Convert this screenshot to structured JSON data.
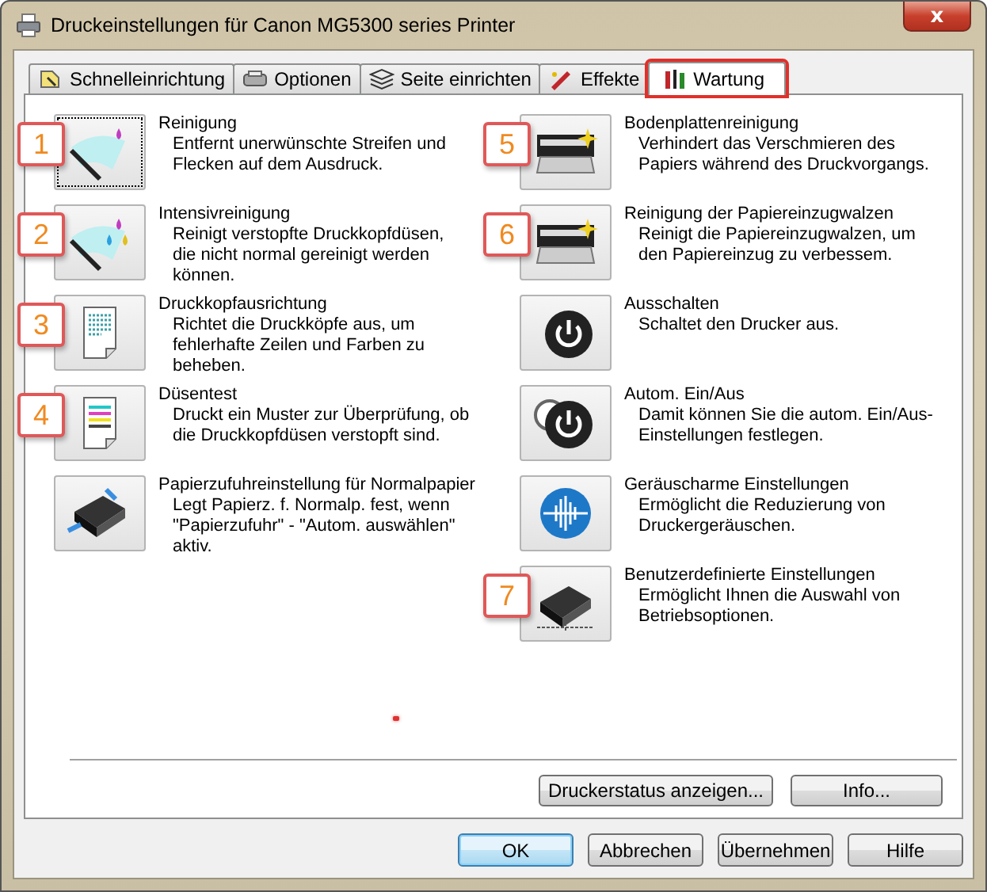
{
  "window": {
    "title": "Druckeinstellungen für Canon MG5300 series Printer",
    "close": "x"
  },
  "tabs": [
    {
      "label": "Schnelleinrichtung",
      "selected": false,
      "highlighted": false
    },
    {
      "label": "Optionen",
      "selected": false,
      "highlighted": false
    },
    {
      "label": "Seite einrichten",
      "selected": false,
      "highlighted": false
    },
    {
      "label": "Effekte",
      "selected": false,
      "highlighted": false
    },
    {
      "label": "Wartung",
      "selected": true,
      "highlighted": true
    }
  ],
  "left_items": [
    {
      "title": "Reinigung",
      "description": "Entfernt unerwünschte Streifen und Flecken auf dem Ausdruck.",
      "callout": "1",
      "focused": true
    },
    {
      "title": "Intensivreinigung",
      "description": "Reinigt verstopfte Druckkopfdüsen, die nicht normal gereinigt werden können.",
      "callout": "2",
      "focused": false
    },
    {
      "title": "Druckkopfausrichtung",
      "description": "Richtet die Druckköpfe aus, um fehlerhafte Zeilen und Farben zu beheben.",
      "callout": "3",
      "focused": false
    },
    {
      "title": "Düsentest",
      "description": "Druckt ein Muster zur Überprüfung, ob die Druckkopfdüsen verstopft sind.",
      "callout": "4",
      "focused": false
    },
    {
      "title": "Papierzufuhreinstellung für Normalpapier",
      "description": "Legt Papierz. f. Normalp. fest, wenn \"Papierzufuhr\" - \"Autom. auswählen\" aktiv.",
      "focused": false
    }
  ],
  "right_items": [
    {
      "title": "Bodenplattenreinigung",
      "description": "Verhindert das Verschmieren des Papiers während des Druckvorgangs.",
      "callout": "5",
      "focused": false
    },
    {
      "title": "Reinigung der Papiereinzugwalzen",
      "description": "Reinigt die Papiereinzugwalzen, um den Papiereinzug zu verbessem.",
      "callout": "6",
      "focused": false
    },
    {
      "title": "Ausschalten",
      "description": "Schaltet den Drucker aus.",
      "focused": false
    },
    {
      "title": "Autom. Ein/Aus",
      "description": "Damit können Sie die autom. Ein/Aus-Einstellungen festlegen.",
      "focused": false
    },
    {
      "title": "Geräuscharme Einstellungen",
      "description": "Ermöglicht die Reduzierung von Druckergeräuschen.",
      "focused": false
    },
    {
      "title": "Benutzerdefinierte Einstellungen",
      "description": "Ermöglicht Ihnen die Auswahl von Betriebsoptionen.",
      "callout": "7",
      "focused": false
    }
  ],
  "panel_buttons": [
    "Druckerstatus anzeigen...",
    "Info..."
  ],
  "dialog_buttons": [
    {
      "label": "OK",
      "default": true
    },
    {
      "label": "Abbrechen",
      "default": false
    },
    {
      "label": "Übernehmen",
      "default": false
    },
    {
      "label": "Hilfe",
      "default": false
    }
  ]
}
